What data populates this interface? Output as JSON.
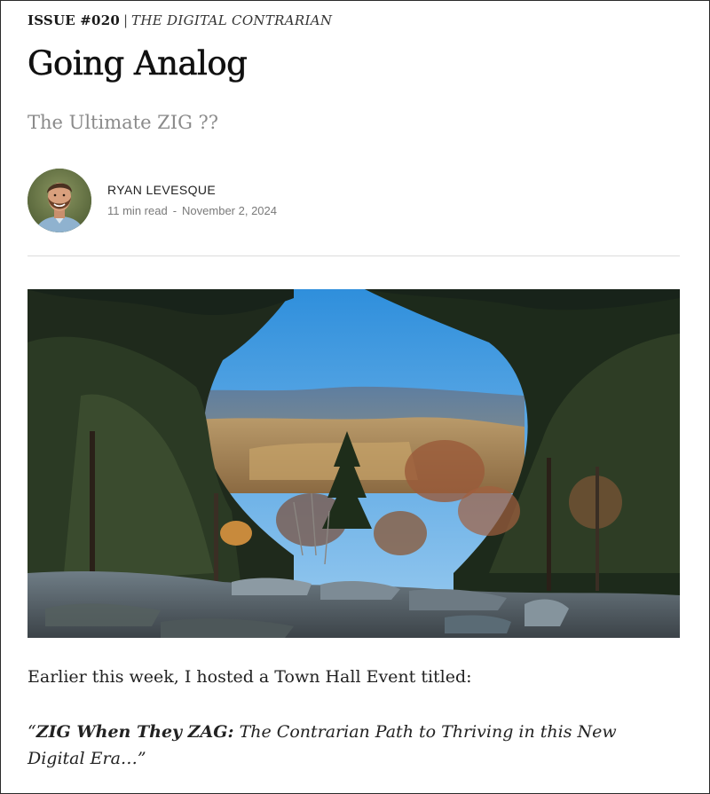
{
  "header": {
    "issue": "ISSUE #020",
    "separator": "|",
    "publication": "THE DIGITAL CONTRARIAN"
  },
  "article": {
    "title": "Going Analog",
    "subtitle": "The Ultimate ZIG ??",
    "author": {
      "name": "RYAN LEVESQUE",
      "read_time": "11 min read",
      "dot": "-",
      "date": "November 2, 2024"
    },
    "body": {
      "intro": "Earlier this week, I hosted a Town Hall Event titled:",
      "quote_open": "“",
      "quote_bold": "ZIG When They ZAG:",
      "quote_rest": " The Contrarian Path to Thriving in this New Digital Era…”"
    }
  },
  "colors": {
    "title": "#111111",
    "subtitle": "#8a8a8a",
    "meta": "#7a7a7a",
    "divider": "#dcdcdc"
  }
}
